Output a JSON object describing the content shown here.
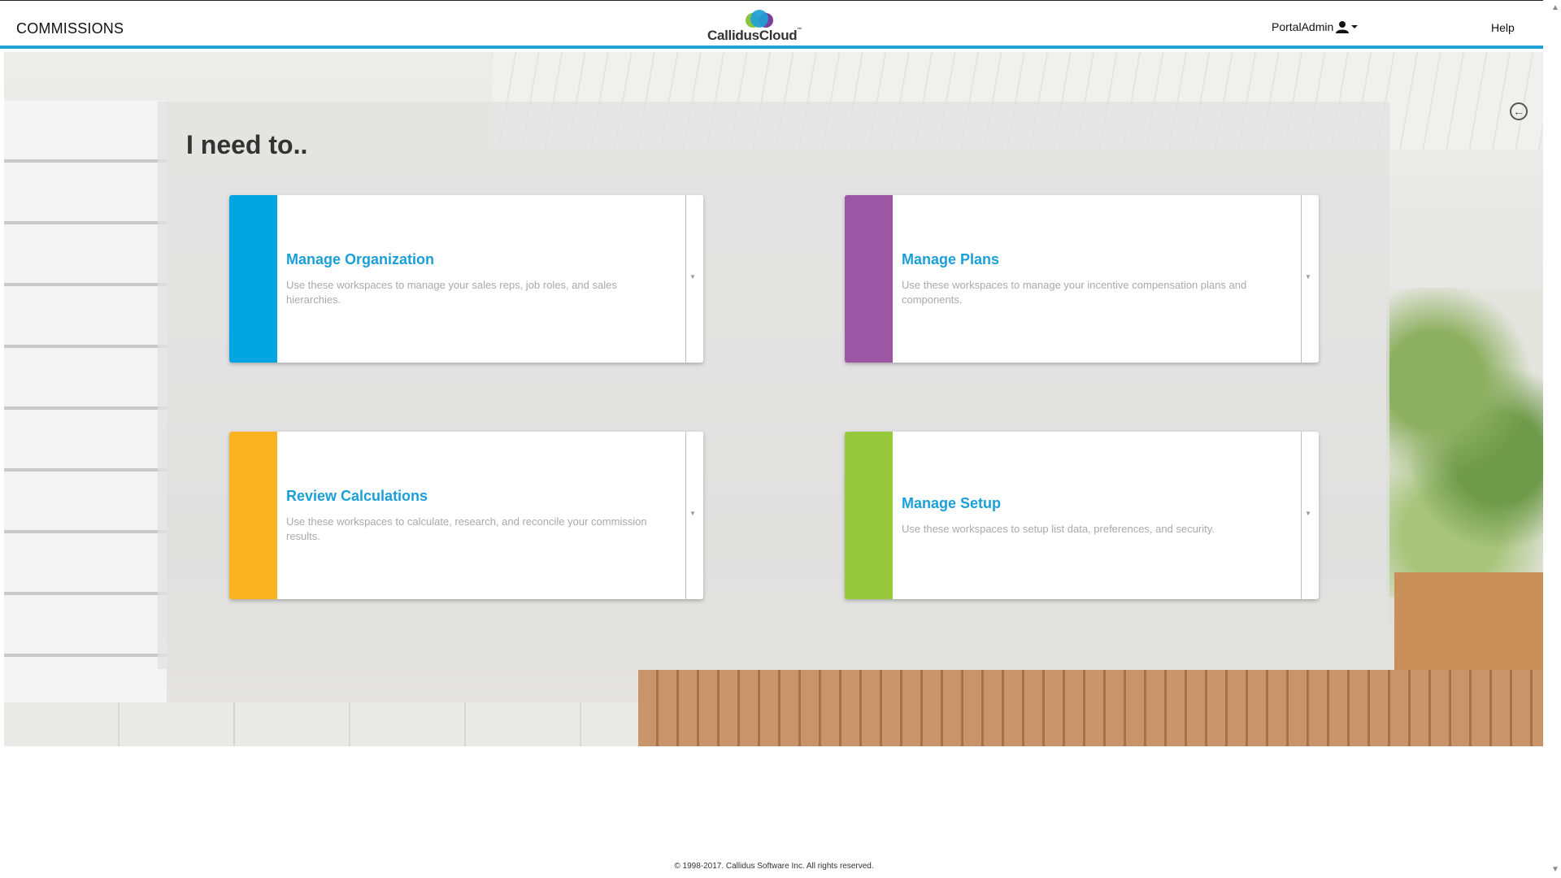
{
  "header": {
    "app_name": "COMMISSIONS",
    "logo_text": "CallidusCloud",
    "logo_colors": [
      "#1fa0d6",
      "#8cc63f",
      "#7b3f99"
    ],
    "user_label": "PortalAdmin",
    "user_icon": "user-icon",
    "help_label": "Help"
  },
  "main": {
    "title": "I need to..",
    "back_icon": "back-arrow-circle-icon",
    "cards": [
      {
        "title": "Manage Organization",
        "description": "Use these workspaces to manage your sales reps, job roles, and sales hierarchies.",
        "color": "#00a6e2"
      },
      {
        "title": "Manage Plans",
        "description": "Use these workspaces to manage your incentive compensation plans and components.",
        "color": "#9b57a3"
      },
      {
        "title": "Review Calculations",
        "description": "Use these workspaces to calculate, research, and reconcile your commission results.",
        "color": "#fbb321"
      },
      {
        "title": "Manage Setup",
        "description": "Use these workspaces to setup list data, preferences, and security.",
        "color": "#98c93c"
      }
    ]
  },
  "footer": {
    "copyright": "© 1998-2017. Callidus Software Inc. All rights reserved."
  }
}
